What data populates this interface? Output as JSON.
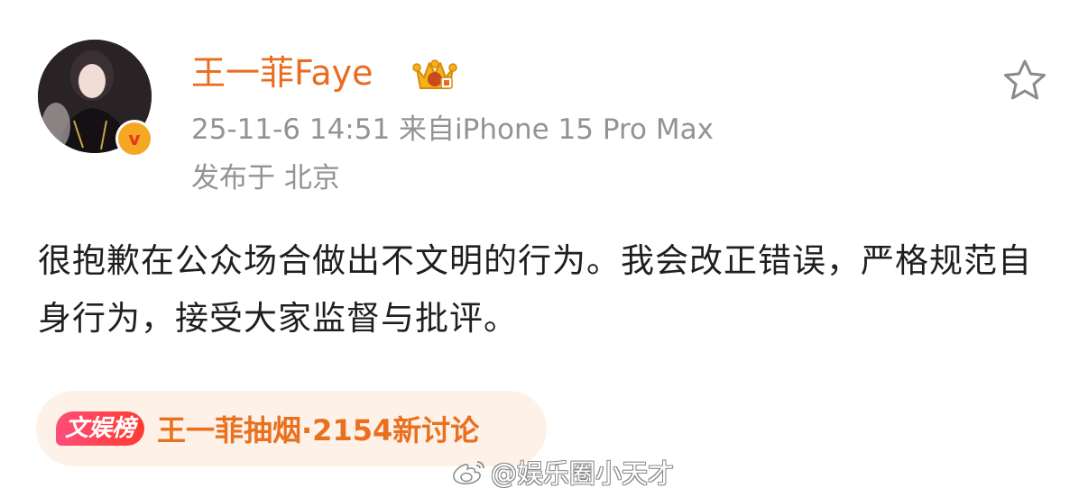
{
  "author": {
    "name": "王一菲Faye",
    "verified_mark": "v",
    "avatar_icon": "profile-photo",
    "member_badge_icon": "gold-crown-badge-icon"
  },
  "meta": {
    "time_source": "25-11-6 14:51  来自iPhone 15 Pro Max",
    "location": "发布于 北京"
  },
  "actions": {
    "favorite_icon": "star-icon"
  },
  "post": {
    "text": "很抱歉在公众场合做出不文明的行为。我会改正错误，严格规范自身行为，接受大家监督与批评。"
  },
  "topic": {
    "tag": "文娱榜",
    "text": "王一菲抽烟·2154新讨论"
  },
  "watermark": {
    "text": "@娱乐圈小天才",
    "icon": "weibo-logo-icon"
  },
  "colors": {
    "name_orange": "#e96b1f",
    "meta_gray": "#939393",
    "body_text": "#1f1f1f",
    "pill_bg": "#fdf1e8",
    "tag_red": "#ff3b30",
    "topic_orange": "#e8701e",
    "verified_gold": "#f5a623"
  }
}
